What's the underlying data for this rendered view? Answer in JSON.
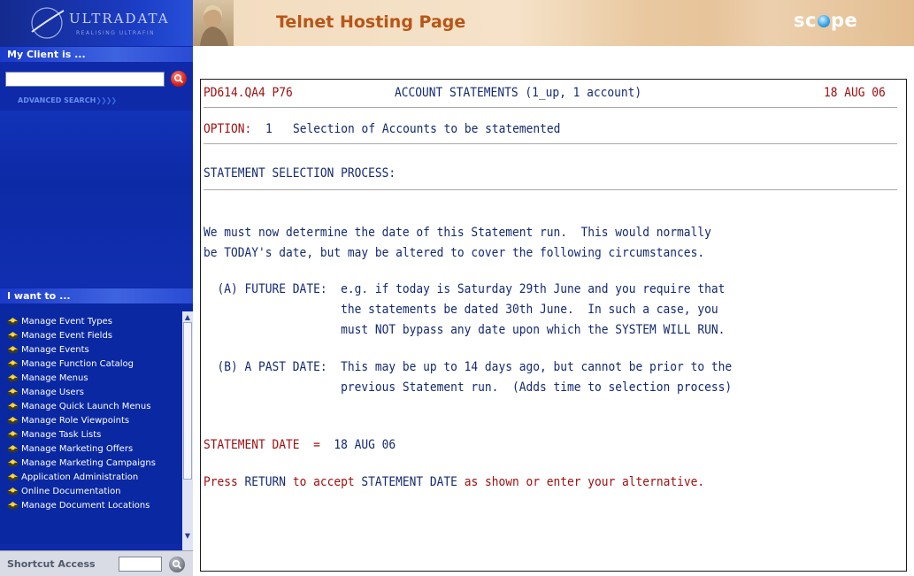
{
  "sidebar": {
    "logo_text": "ULTRADATA",
    "logo_tagline": "REALISING ULTRAFIN",
    "client_header": "My Client is ...",
    "advanced_search": "ADVANCED SEARCH",
    "iwant_header": "I want to ...",
    "iwant_items": [
      "Manage Event Types",
      "Manage Event Fields",
      "Manage Events",
      "Manage Function Catalog",
      "Manage Menus",
      "Manage Users",
      "Manage Quick Launch Menus",
      "Manage Role Viewpoints",
      "Manage Task Lists",
      "Manage Marketing Offers",
      "Manage Marketing Campaigns",
      "Application Administration",
      "Online Documentation",
      "Manage Document Locations"
    ],
    "shortcut_label": "Shortcut Access"
  },
  "header": {
    "title": "Telnet Hosting Page",
    "logo": "scope"
  },
  "terminal": {
    "program_id": "PD614.QA4 P76",
    "screen_title": "ACCOUNT STATEMENTS (1_up, 1 account)",
    "date": "18 AUG 06",
    "option_label": "OPTION:",
    "option_value": "1   Selection of Accounts to be statemented",
    "process_title": "STATEMENT SELECTION PROCESS:",
    "intro_1": "We must now determine the date of this Statement run.  This would normally",
    "intro_2": "be TODAY's date, but may be altered to cover the following circumstances.",
    "future_1": "  (A) FUTURE DATE:  e.g. if today is Saturday 29th June and you require that",
    "future_2": "                    the statements be dated 30th June.  In such a case, you",
    "future_3": "                    must NOT bypass any date upon which the SYSTEM WILL RUN.",
    "past_1": "  (B) A PAST DATE:  This may be up to 14 days ago, but cannot be prior to the",
    "past_2": "                    previous Statement run.  (Adds time to selection process)",
    "stmt_date_label": "STATEMENT DATE  =  ",
    "stmt_date_value": "18 AUG 06",
    "prompt_pre": "Press ",
    "prompt_return": "RETURN",
    "prompt_mid": " to accept ",
    "prompt_stmt": "STATEMENT DATE",
    "prompt_post": " as shown or enter your alternative."
  },
  "colors": {
    "sidebar_bg": "#0e2aa8",
    "title_orange": "#b75616",
    "terminal_red": "#a00f10",
    "terminal_blue": "#142a70"
  }
}
